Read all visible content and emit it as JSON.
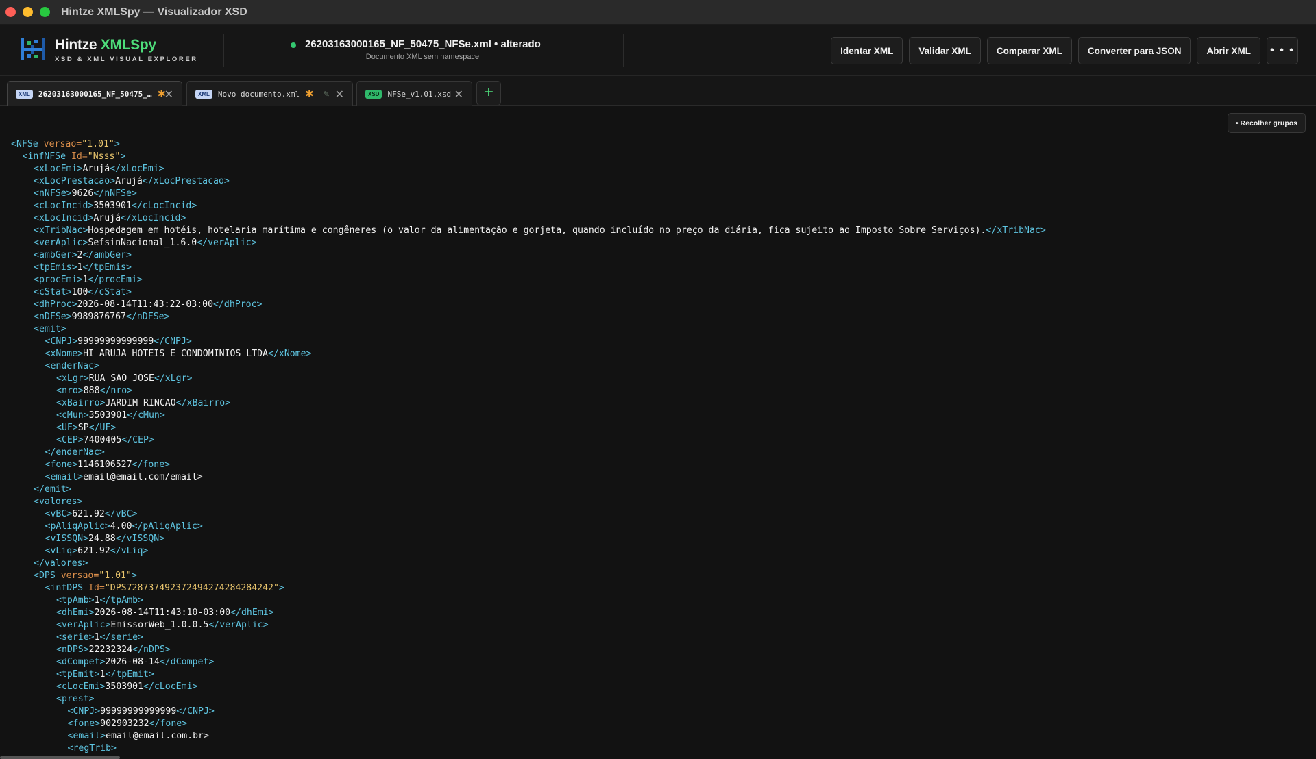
{
  "window": {
    "title": "Hintze XMLSpy — Visualizador XSD"
  },
  "brand": {
    "name_part1": "Hintze ",
    "name_part2": "XMLSpy",
    "subtitle": "XSD & XML VISUAL EXPLORER"
  },
  "document": {
    "filename": "26203163000165_NF_50475_NFSe.xml",
    "status": " • alterado",
    "subtitle": "Documento XML sem namespace"
  },
  "toolbar": {
    "indent": "Identar XML",
    "validate": "Validar XML",
    "compare": "Comparar XML",
    "convert": "Converter para JSON",
    "open": "Abrir XML",
    "more": "• • •"
  },
  "tabs": [
    {
      "badge": "XML",
      "label": "26203163000165_NF_50475_…",
      "modified": "✱",
      "close": "✕"
    },
    {
      "badge": "XML",
      "label": "Novo documento.xml",
      "modified": "✱",
      "edit": "✎",
      "close": "✕"
    },
    {
      "badge": "XSD",
      "label": "NFSe_v1.01.xsd",
      "close": "✕"
    }
  ],
  "add_tab": "+",
  "editor": {
    "collapse_label": "• Recolher grupos",
    "lines": [
      {
        "d": 0,
        "k": "open",
        "t": "NFSe",
        "a": "versao",
        "v": "1.01"
      },
      {
        "d": 1,
        "k": "open",
        "t": "infNFSe",
        "a": "Id",
        "v": "Nsss"
      },
      {
        "d": 2,
        "k": "leaf",
        "t": "xLocEmi",
        "x": "Arujá"
      },
      {
        "d": 2,
        "k": "leaf",
        "t": "xLocPrestacao",
        "x": "Arujá"
      },
      {
        "d": 2,
        "k": "leaf",
        "t": "nNFSe",
        "x": "9626"
      },
      {
        "d": 2,
        "k": "leaf",
        "t": "cLocIncid",
        "x": "3503901"
      },
      {
        "d": 2,
        "k": "leaf",
        "t": "xLocIncid",
        "x": "Arujá"
      },
      {
        "d": 2,
        "k": "leaf",
        "t": "xTribNac",
        "x": "Hospedagem em hotéis, hotelaria marítima e congêneres (o valor da alimentação e gorjeta, quando incluído no preço da diária, fica sujeito ao Imposto Sobre Serviços)."
      },
      {
        "d": 2,
        "k": "leaf",
        "t": "verAplic",
        "x": "SefsinNacional_1.6.0"
      },
      {
        "d": 2,
        "k": "leaf",
        "t": "ambGer",
        "x": "2"
      },
      {
        "d": 2,
        "k": "leaf",
        "t": "tpEmis",
        "x": "1"
      },
      {
        "d": 2,
        "k": "leaf",
        "t": "procEmi",
        "x": "1"
      },
      {
        "d": 2,
        "k": "leaf",
        "t": "cStat",
        "x": "100"
      },
      {
        "d": 2,
        "k": "leaf",
        "t": "dhProc",
        "x": "2026-08-14T11:43:22-03:00"
      },
      {
        "d": 2,
        "k": "leaf",
        "t": "nDFSe",
        "x": "9989876767"
      },
      {
        "d": 2,
        "k": "open",
        "t": "emit"
      },
      {
        "d": 3,
        "k": "leaf",
        "t": "CNPJ",
        "x": "99999999999999"
      },
      {
        "d": 3,
        "k": "leaf",
        "t": "xNome",
        "x": "HI ARUJA HOTEIS E CONDOMINIOS LTDA"
      },
      {
        "d": 3,
        "k": "open",
        "t": "enderNac"
      },
      {
        "d": 4,
        "k": "leaf",
        "t": "xLgr",
        "x": "RUA SAO JOSE"
      },
      {
        "d": 4,
        "k": "leaf",
        "t": "nro",
        "x": "888"
      },
      {
        "d": 4,
        "k": "leaf",
        "t": "xBairro",
        "x": "JARDIM RINCAO"
      },
      {
        "d": 4,
        "k": "leaf",
        "t": "cMun",
        "x": "3503901"
      },
      {
        "d": 4,
        "k": "leaf",
        "t": "UF",
        "x": "SP"
      },
      {
        "d": 4,
        "k": "leaf",
        "t": "CEP",
        "x": "7400405"
      },
      {
        "d": 3,
        "k": "close",
        "t": "enderNac"
      },
      {
        "d": 3,
        "k": "leaf",
        "t": "fone",
        "x": "1146106527"
      },
      {
        "d": 3,
        "k": "opentext",
        "t": "email",
        "x": "email@email.com/email>"
      },
      {
        "d": 2,
        "k": "close",
        "t": "emit"
      },
      {
        "d": 2,
        "k": "open",
        "t": "valores"
      },
      {
        "d": 3,
        "k": "leaf",
        "t": "vBC",
        "x": "621.92"
      },
      {
        "d": 3,
        "k": "leaf",
        "t": "pAliqAplic",
        "x": "4.00"
      },
      {
        "d": 3,
        "k": "leaf",
        "t": "vISSQN",
        "x": "24.88"
      },
      {
        "d": 3,
        "k": "leaf",
        "t": "vLiq",
        "x": "621.92"
      },
      {
        "d": 2,
        "k": "close",
        "t": "valores"
      },
      {
        "d": 2,
        "k": "open",
        "t": "DPS",
        "a": "versao",
        "v": "1.01"
      },
      {
        "d": 3,
        "k": "open",
        "t": "infDPS",
        "a": "Id",
        "v": "DPS728737492372494274284284242"
      },
      {
        "d": 4,
        "k": "leaf",
        "t": "tpAmb",
        "x": "1"
      },
      {
        "d": 4,
        "k": "leaf",
        "t": "dhEmi",
        "x": "2026-08-14T11:43:10-03:00"
      },
      {
        "d": 4,
        "k": "leaf",
        "t": "verAplic",
        "x": "EmissorWeb_1.0.0.5"
      },
      {
        "d": 4,
        "k": "leaf",
        "t": "serie",
        "x": "1"
      },
      {
        "d": 4,
        "k": "leaf",
        "t": "nDPS",
        "x": "22232324"
      },
      {
        "d": 4,
        "k": "leaf",
        "t": "dCompet",
        "x": "2026-08-14"
      },
      {
        "d": 4,
        "k": "leaf",
        "t": "tpEmit",
        "x": "1"
      },
      {
        "d": 4,
        "k": "leaf",
        "t": "cLocEmi",
        "x": "3503901"
      },
      {
        "d": 4,
        "k": "open",
        "t": "prest"
      },
      {
        "d": 5,
        "k": "leaf",
        "t": "CNPJ",
        "x": "99999999999999"
      },
      {
        "d": 5,
        "k": "leaf",
        "t": "fone",
        "x": "902903232"
      },
      {
        "d": 5,
        "k": "opentext",
        "t": "email",
        "x": "email@email.com.br>"
      },
      {
        "d": 5,
        "k": "open",
        "t": "regTrib"
      }
    ]
  }
}
